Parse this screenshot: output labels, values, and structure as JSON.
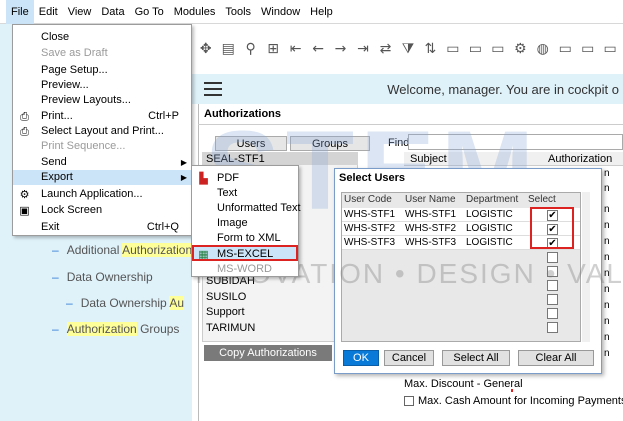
{
  "menubar": {
    "items": [
      "File",
      "Edit",
      "View",
      "Data",
      "Go To",
      "Modules",
      "Tools",
      "Window",
      "Help"
    ]
  },
  "toolbar": {
    "icons": [
      "move-icon",
      "layout-icon",
      "find-icon",
      "add-icon",
      "first-icon",
      "prev-icon",
      "next-icon",
      "last-icon",
      "refresh-icon",
      "filter-icon",
      "sort-icon",
      "doc-icon",
      "doc2-icon",
      "doc3-icon",
      "doc4-icon",
      "doc5-icon",
      "doc6-icon",
      "doc7-icon",
      "doc8-icon"
    ]
  },
  "welcome": {
    "text": "Welcome, manager. You are in cockpit o"
  },
  "file_menu": {
    "items": [
      {
        "label": "Close",
        "shortcut": "",
        "disabled": false
      },
      {
        "label": "Save as Draft",
        "shortcut": "",
        "disabled": true
      },
      {
        "label": "Page Setup...",
        "shortcut": "",
        "disabled": false
      },
      {
        "label": "Preview...",
        "shortcut": "",
        "disabled": false
      },
      {
        "label": "Preview Layouts...",
        "shortcut": "",
        "disabled": false
      },
      {
        "label": "Print...",
        "shortcut": "Ctrl+P",
        "disabled": false
      },
      {
        "label": "Select Layout and Print...",
        "shortcut": "",
        "disabled": false
      },
      {
        "label": "Print Sequence...",
        "shortcut": "",
        "disabled": true
      },
      {
        "label": "Send",
        "shortcut": "",
        "disabled": false
      },
      {
        "label": "Export",
        "shortcut": "",
        "disabled": false
      },
      {
        "label": "Launch Application...",
        "shortcut": "",
        "disabled": false
      },
      {
        "label": "Lock Screen",
        "shortcut": "",
        "disabled": false
      },
      {
        "label": "Exit",
        "shortcut": "Ctrl+Q",
        "disabled": false
      }
    ]
  },
  "export_menu": {
    "items": [
      {
        "label": "PDF",
        "disabled": false
      },
      {
        "label": "Text",
        "disabled": false
      },
      {
        "label": "Unformatted Text",
        "disabled": false
      },
      {
        "label": "Image",
        "disabled": false
      },
      {
        "label": "Form to XML",
        "disabled": false
      },
      {
        "label": "MS-EXCEL",
        "disabled": false
      },
      {
        "label": "MS-WORD",
        "disabled": true
      }
    ]
  },
  "tree": {
    "item1_pre": "Additional ",
    "item1_hl": "Authorization",
    "item2": "Data Ownership",
    "item3_pre": "Data Ownership ",
    "item3_hl": "Au",
    "item4_hl": "Authorization",
    "item4_post": " Groups"
  },
  "auth": {
    "title": "Authorizations",
    "tab_users": "Users",
    "tab_groups": "Groups",
    "find_label": "Find",
    "user_first": "SEAL-STF1",
    "users": [
      "SUBIDAH",
      "SUSILO",
      "Support",
      "TARIMUN"
    ],
    "copy_button": "Copy Authorizations",
    "grid_header_subject": "Subject",
    "grid_header_auth": "Authorization",
    "grid_edge": [
      "n",
      "n",
      "n",
      "n",
      "n",
      "n",
      "n",
      "n",
      "n",
      "n",
      "n",
      "n"
    ]
  },
  "dialog": {
    "title": "Select Users",
    "columns": [
      "User Code",
      "User Name",
      "Department",
      "Select"
    ],
    "rows": [
      {
        "code": "WHS-STF1",
        "name": "WHS-STF1",
        "dept": "LOGISTIC",
        "selected": true
      },
      {
        "code": "WHS-STF2",
        "name": "WHS-STF2",
        "dept": "LOGISTIC",
        "selected": true
      },
      {
        "code": "WHS-STF3",
        "name": "WHS-STF3",
        "dept": "LOGISTIC",
        "selected": true
      }
    ],
    "ok": "OK",
    "cancel": "Cancel",
    "select_all": "Select All",
    "clear_all": "Clear All"
  },
  "bottom": {
    "max_discount": "Max. Discount - General",
    "max_cash": "Max. Cash Amount for Incoming Payments"
  },
  "watermark": {
    "text": "STEM",
    "sub": "INNOVATION • DESIGN • VALUE"
  },
  "colors": {
    "accent": "#0a7ad8",
    "highlight_box": "#dd2222",
    "menu_hover": "#cce4f7",
    "pane_bg": "#dff1f9"
  }
}
